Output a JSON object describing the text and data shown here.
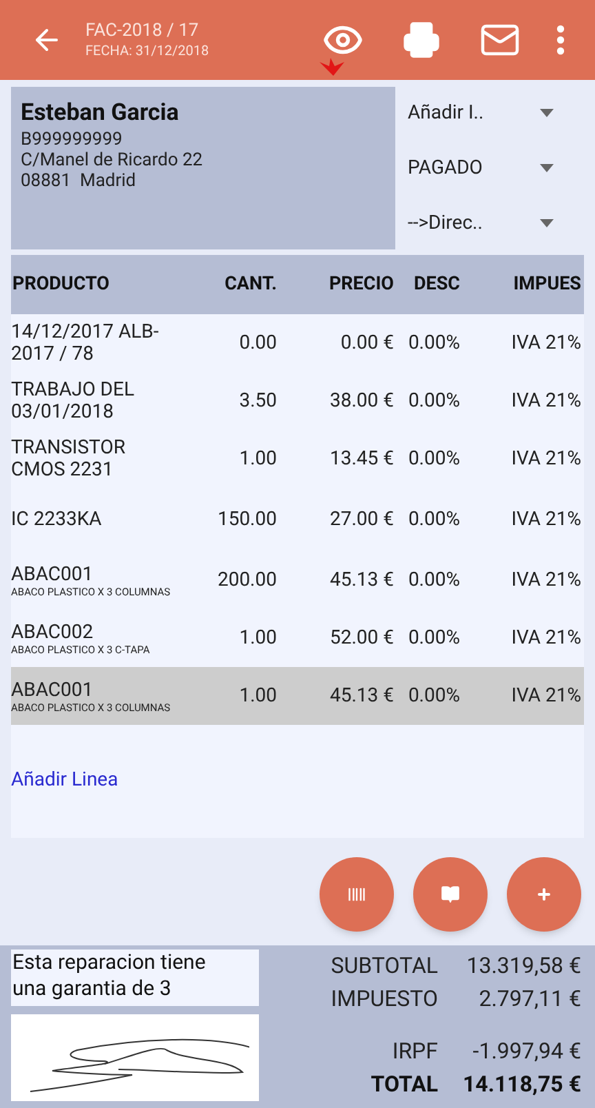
{
  "header": {
    "title": "FAC-2018 / 17",
    "subtitle": "FECHA: 31/12/2018"
  },
  "customer": {
    "name": "Esteban Garcia",
    "lines": [
      "B999999999",
      "C/Manel de Ricardo 22",
      "08881  Madrid"
    ]
  },
  "dropdowns": [
    {
      "value": "Añadir I.."
    },
    {
      "value": "PAGADO"
    },
    {
      "value": "-->Direc.."
    }
  ],
  "table": {
    "columns": [
      "PRODUCTO",
      "CANT.",
      "PRECIO",
      "DESC",
      "IMPUES"
    ],
    "rows": [
      {
        "product": "14/12/2017 ALB-2017 / 78",
        "qty": "0.00",
        "price": "0.00 €",
        "disc": "0.00%",
        "tax": "IVA 21%",
        "selected": false
      },
      {
        "product": "TRABAJO DEL 03/01/2018",
        "qty": "3.50",
        "price": "38.00 €",
        "disc": "0.00%",
        "tax": "IVA 21%",
        "selected": false
      },
      {
        "product": "TRANSISTOR CMOS 2231",
        "qty": "1.00",
        "price": "13.45 €",
        "disc": "0.00%",
        "tax": "IVA 21%",
        "selected": false
      },
      {
        "product": "IC 2233KA",
        "qty": "150.00",
        "price": "27.00 €",
        "disc": "0.00%",
        "tax": "IVA 21%",
        "selected": false
      },
      {
        "product": "ABAC001",
        "detail": "ABACO PLASTICO X 3 COLUMNAS",
        "qty": "200.00",
        "price": "45.13 €",
        "disc": "0.00%",
        "tax": "IVA 21%",
        "selected": false
      },
      {
        "product": "ABAC002",
        "detail": "ABACO PLASTICO X 3 C-TAPA",
        "qty": "1.00",
        "price": "52.00 €",
        "disc": "0.00%",
        "tax": "IVA 21%",
        "selected": false
      },
      {
        "product": "ABAC001",
        "detail": "ABACO PLASTICO X 3 COLUMNAS",
        "qty": "1.00",
        "price": "45.13 €",
        "disc": "0.00%",
        "tax": "IVA 21%",
        "selected": true
      }
    ],
    "add_link": "Añadir Linea"
  },
  "fab_buttons": [
    {
      "kind": "barcode"
    },
    {
      "kind": "book"
    },
    {
      "kind": "add"
    }
  ],
  "notes": "Esta reparacion tiene una garantia de 3",
  "totals": [
    {
      "label": "SUBTOTAL",
      "value": "13.319,58 €",
      "kind": "plain"
    },
    {
      "label": "IMPUESTO",
      "value": "2.797,11 €",
      "kind": "plain"
    },
    {
      "label": "IRPF",
      "value": "-1.997,94 €",
      "kind": "gap"
    },
    {
      "label": "TOTAL",
      "value": "14.118,75 €",
      "kind": "total"
    }
  ]
}
